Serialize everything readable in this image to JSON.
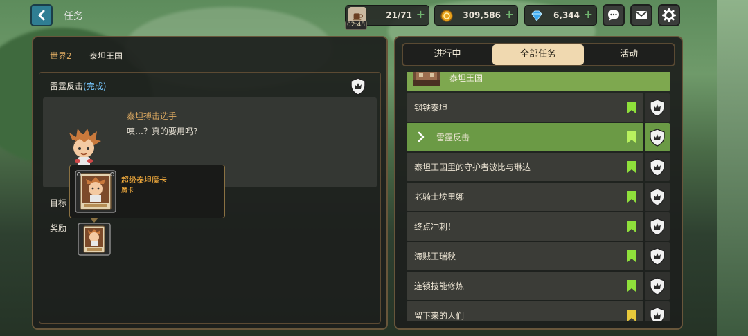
{
  "header": {
    "back_label": "",
    "title": "任务"
  },
  "resources": {
    "stamina": {
      "value": "21/71",
      "timer": "02:48"
    },
    "gold": {
      "value": "309,586"
    },
    "gems": {
      "value": "6,344"
    },
    "plus_symbol": "+"
  },
  "breadcrumb": {
    "world": "世界2",
    "place": "泰坦王国"
  },
  "quest_detail": {
    "name": "雷霆反击",
    "status": "(完成)",
    "npc_name": "泰坦搏击选手",
    "npc_line": "咦…？真的要用吗?",
    "target_label": "目标",
    "reward_label": "奖励"
  },
  "tooltip": {
    "title": "超级泰坦魔卡",
    "subtitle": "魔卡"
  },
  "tabs": [
    {
      "label": "进行中",
      "active": false
    },
    {
      "label": "全部任务",
      "active": true
    },
    {
      "label": "活动",
      "active": false
    }
  ],
  "quest_group": {
    "title": "泰坦王国"
  },
  "quests": [
    {
      "label": "钢铁泰坦",
      "active": false,
      "flag_color": "#8fe03b"
    },
    {
      "label": "雷霆反击",
      "active": true,
      "flag_color": "#b9f25e"
    },
    {
      "label": "泰坦王国里的守护者波比与琳达",
      "active": false,
      "flag_color": "#8fe03b"
    },
    {
      "label": "老骑士埃里娜",
      "active": false,
      "flag_color": "#8fe03b"
    },
    {
      "label": "终点冲刺！",
      "active": false,
      "flag_color": "#8fe03b"
    },
    {
      "label": "海贼王瑞秋",
      "active": false,
      "flag_color": "#8fe03b"
    },
    {
      "label": "连锁技能修炼",
      "active": false,
      "flag_color": "#8fe03b"
    },
    {
      "label": "留下来的人们",
      "active": false,
      "flag_color": "#e8c93b"
    }
  ],
  "colors": {
    "accent_gold": "#d9a760",
    "active_row": "#6b9a45",
    "complete_blue": "#77c7ff",
    "tooltip_title": "#ffb43f"
  }
}
